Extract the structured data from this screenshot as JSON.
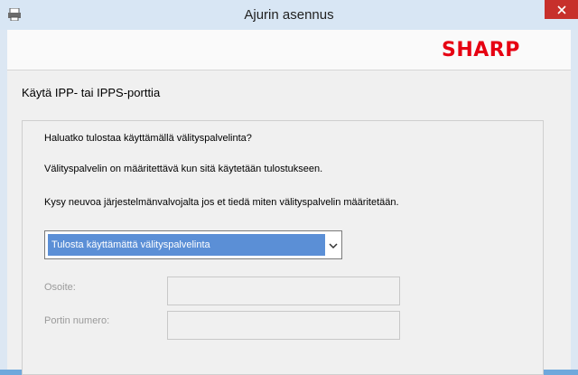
{
  "window": {
    "title": "Ajurin asennus"
  },
  "header": {
    "logo_text": "SHARP",
    "logo_color": "#e60012"
  },
  "page": {
    "heading": "Käytä IPP- tai IPPS-porttia"
  },
  "messages": [
    "Haluatko tulostaa käyttämällä välityspalvelinta?",
    "Välityspalvelin on määritettävä kun sitä käytetään tulostukseen.",
    "Kysy neuvoa järjestelmänvalvojalta jos et tiedä miten välityspalvelin määritetään."
  ],
  "proxy_select": {
    "selected": "Tulosta käyttämättä välityspalvelinta"
  },
  "fields": {
    "address_label": "Osoite:",
    "address_value": "",
    "port_label": "Portin numero:",
    "port_value": ""
  },
  "colors": {
    "selection": "#5b8fd6",
    "close": "#c7302b",
    "titlebar": "#d8e6f4"
  }
}
